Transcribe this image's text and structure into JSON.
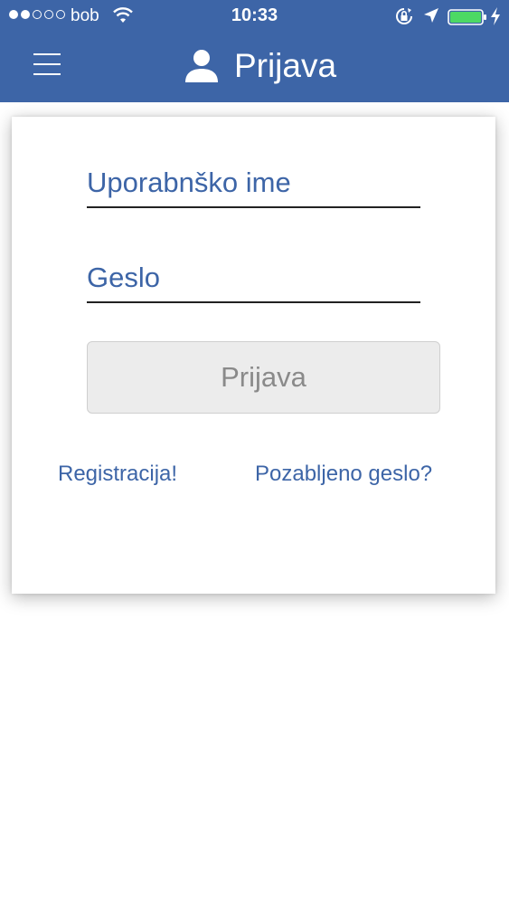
{
  "status_bar": {
    "carrier": "bob",
    "time": "10:33",
    "signal_bars_filled": 2,
    "signal_bars_total": 5
  },
  "header": {
    "title": "Prijava",
    "background_color": "#3d65a7",
    "menu_icon": "hamburger-menu-icon",
    "title_icon": "user-icon"
  },
  "form": {
    "username_placeholder": "Uporabnško ime",
    "username_value": "",
    "password_placeholder": "Geslo",
    "password_value": "",
    "login_button_label": "Prijava"
  },
  "links": {
    "register": "Registracija!",
    "forgot_password": "Pozabljeno geslo?"
  }
}
